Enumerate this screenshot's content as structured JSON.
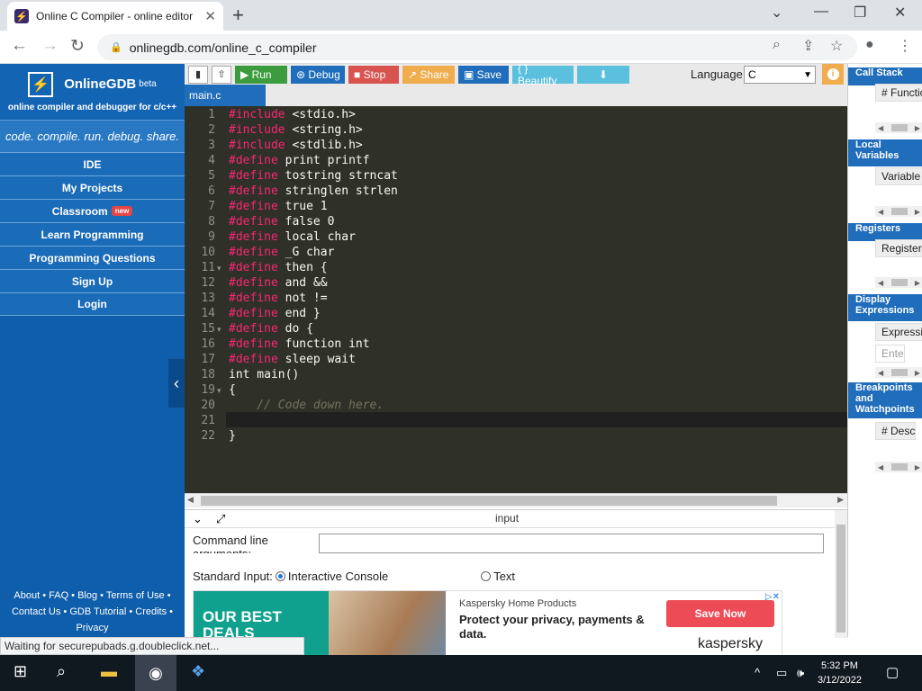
{
  "browser": {
    "tab_title": "Online C Compiler - online editor",
    "url": "onlinegdb.com/online_c_compiler",
    "status_text": "Waiting for securepubads.g.doubleclick.net..."
  },
  "sidebar": {
    "brand": "OnlineGDB",
    "beta": "beta",
    "tagline": "online compiler and debugger for c/c++",
    "motto": "code. compile. run. debug. share.",
    "items": [
      {
        "label": "IDE"
      },
      {
        "label": "My Projects"
      },
      {
        "label": "Classroom",
        "badge": "new"
      },
      {
        "label": "Learn Programming"
      },
      {
        "label": "Programming Questions"
      },
      {
        "label": "Sign Up"
      },
      {
        "label": "Login"
      }
    ],
    "footer": {
      "line1": "About • FAQ • Blog • Terms of Use •",
      "line2": "Contact Us • GDB Tutorial • Credits •",
      "line3": "Privacy"
    }
  },
  "toolbar": {
    "run": "Run",
    "debug": "Debug",
    "stop": "Stop",
    "share": "Share",
    "save": "Save",
    "beautify": "{ } Beautify",
    "language_label": "Language",
    "language_value": "C",
    "colors": {
      "run": "#3c9b3c",
      "debug": "#1f6dbb",
      "stop": "#d9534f",
      "share": "#f0ad4e",
      "save": "#1f6dbb",
      "beautify": "#5bc0de",
      "download": "#5bc0de"
    }
  },
  "editor": {
    "file_tab": "main.c",
    "lines": [
      {
        "n": "1",
        "kw": "#include",
        "rest": " <stdio.h>"
      },
      {
        "n": "2",
        "kw": "#include",
        "rest": " <string.h>"
      },
      {
        "n": "3",
        "kw": "#include",
        "rest": " <stdlib.h>"
      },
      {
        "n": "4",
        "kw": "#define",
        "rest": " print printf"
      },
      {
        "n": "5",
        "kw": "#define",
        "rest": " tostring strncat"
      },
      {
        "n": "6",
        "kw": "#define",
        "rest": " stringlen strlen"
      },
      {
        "n": "7",
        "kw": "#define",
        "rest": " true 1"
      },
      {
        "n": "8",
        "kw": "#define",
        "rest": " false 0"
      },
      {
        "n": "9",
        "kw": "#define",
        "rest": " local char"
      },
      {
        "n": "10",
        "kw": "#define",
        "rest": " _G char"
      },
      {
        "n": "11",
        "kw": "#define",
        "rest": " then {"
      },
      {
        "n": "12",
        "kw": "#define",
        "rest": " and &&"
      },
      {
        "n": "13",
        "kw": "#define",
        "rest": " not !="
      },
      {
        "n": "14",
        "kw": "#define",
        "rest": " end }"
      },
      {
        "n": "15",
        "kw": "#define",
        "rest": " do {"
      },
      {
        "n": "16",
        "kw": "#define",
        "rest": " function int"
      },
      {
        "n": "17",
        "kw": "#define",
        "rest": " sleep wait"
      },
      {
        "n": "18",
        "kw": "",
        "rest": "int main()"
      },
      {
        "n": "19",
        "kw": "",
        "rest": "{"
      },
      {
        "n": "20",
        "kw": "",
        "rest": "    // Code down here."
      },
      {
        "n": "21",
        "kw": "",
        "rest": "    "
      },
      {
        "n": "22",
        "kw": "",
        "rest": "}"
      }
    ]
  },
  "input_panel": {
    "title": "input",
    "cmd_label": "Command line arguments:",
    "stdin_label": "Standard Input:",
    "opt_console": "Interactive Console",
    "opt_text": "Text"
  },
  "ad": {
    "left": "OUR BEST DEALS",
    "brand": "Kaspersky Home Products",
    "text": "Protect your privacy, payments & data.",
    "button": "Save Now",
    "logo": "kaspersky"
  },
  "debug_panel": {
    "call_stack": "Call Stack",
    "call_cols": "#  Function",
    "local_vars": "Local Variables",
    "local_cols": "Variable  Value",
    "registers": "Registers",
    "reg_cols": "Register",
    "display_expr": "Display Expressions",
    "expr_cols": "Expression  Value",
    "expr_placeholder": "Ente",
    "breakpoints": "Breakpoints and Watchpoints",
    "bp_cols": "#  Desc"
  },
  "taskbar": {
    "time": "5:32 PM",
    "date": "3/12/2022"
  }
}
